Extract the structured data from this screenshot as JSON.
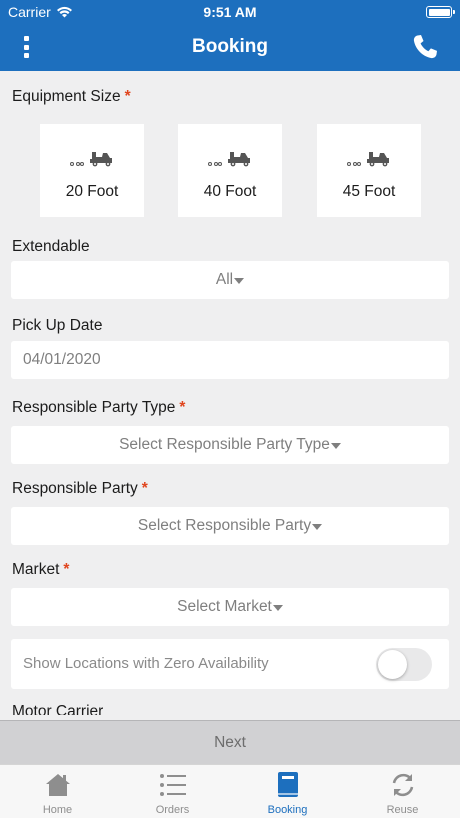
{
  "status_bar": {
    "carrier": "Carrier",
    "time": "9:51 AM"
  },
  "header": {
    "title": "Booking",
    "menu_icon": "vertical-dots-icon",
    "phone_icon": "phone-icon"
  },
  "form": {
    "equipment_size": {
      "label": "Equipment Size",
      "required_mark": "*",
      "options": [
        {
          "label": "20 Foot",
          "icon": "truck-icon"
        },
        {
          "label": "40 Foot",
          "icon": "truck-icon"
        },
        {
          "label": "45 Foot",
          "icon": "truck-icon"
        }
      ]
    },
    "extendable": {
      "label": "Extendable",
      "value": "All"
    },
    "pick_up_date": {
      "label": "Pick Up Date",
      "value": "04/01/2020"
    },
    "responsible_party_type": {
      "label": "Responsible Party Type",
      "required_mark": "*",
      "placeholder": "Select Responsible Party Type"
    },
    "responsible_party": {
      "label": "Responsible Party",
      "required_mark": "*",
      "placeholder": "Select Responsible Party"
    },
    "market": {
      "label": "Market",
      "required_mark": "*",
      "placeholder": "Select Market"
    },
    "zero_availability": {
      "label": "Show Locations with Zero Availability",
      "enabled": false
    },
    "motor_carrier": {
      "label": "Motor Carrier"
    }
  },
  "next_button": {
    "label": "Next"
  },
  "tabs": [
    {
      "label": "Home",
      "icon": "home-icon",
      "active": false
    },
    {
      "label": "Orders",
      "icon": "list-icon",
      "active": false
    },
    {
      "label": "Booking",
      "icon": "book-icon",
      "active": true
    },
    {
      "label": "Reuse",
      "icon": "reuse-icon",
      "active": false
    }
  ],
  "colors": {
    "brand": "#1d6fbe",
    "required": "#e0461f",
    "background": "#efeff0"
  }
}
